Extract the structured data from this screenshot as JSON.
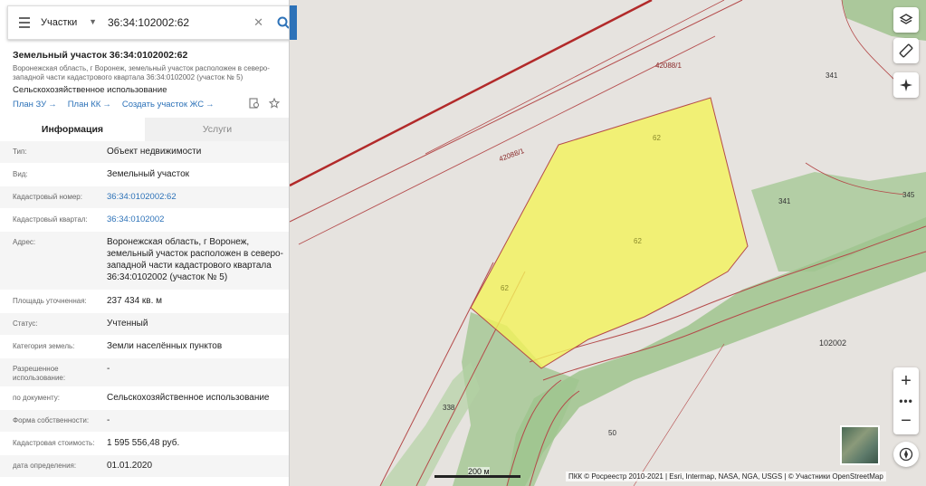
{
  "search": {
    "type": "Участки",
    "value": "36:34:102002:62"
  },
  "object": {
    "title": "Земельный участок 36:34:0102002:62",
    "address_short": "Воронежская область, г Воронеж, земельный участок расположен в северо-западной части кадастрового квартала 36:34:0102002 (участок № 5)",
    "use": "Сельскохозяйственное использование",
    "links": [
      {
        "label": "План ЗУ",
        "arrow": "→"
      },
      {
        "label": "План КК",
        "arrow": "→"
      },
      {
        "label": "Создать участок ЖС",
        "arrow": "→"
      }
    ]
  },
  "tabs": [
    {
      "label": "Информация",
      "active": true
    },
    {
      "label": "Услуги",
      "active": false
    }
  ],
  "rows": [
    {
      "key": "Тип:",
      "value": "Объект недвижимости"
    },
    {
      "key": "Вид:",
      "value": "Земельный участок"
    },
    {
      "key": "Кадастровый номер:",
      "value": "36:34:0102002:62",
      "link": true
    },
    {
      "key": "Кадастровый квартал:",
      "value": "36:34:0102002",
      "link": true
    },
    {
      "key": "Адрес:",
      "value": "Воронежская область, г Воронеж, земельный участок расположен в северо-западной части кадастрового квартала 36:34:0102002 (участок № 5)"
    },
    {
      "key": "Площадь уточненная:",
      "value": "237 434 кв. м"
    },
    {
      "key": "Статус:",
      "value": "Учтенный"
    },
    {
      "key": "Категория земель:",
      "value": "Земли населённых пунктов"
    },
    {
      "key": "Разрешенное использование:",
      "value": "-"
    },
    {
      "key": "по документу:",
      "value": "Сельскохозяйственное использование"
    },
    {
      "key": "Форма собственности:",
      "value": "-"
    },
    {
      "key": "Кадастровая стоимость:",
      "value": "1 595 556,48 руб."
    },
    {
      "key": "дата определения:",
      "value": "01.01.2020"
    }
  ],
  "map": {
    "labels": {
      "l42088_top": "42088/1",
      "l42088_diag": "42088/1",
      "l341_top": "341",
      "l341_mid": "341",
      "l345": "345",
      "l62_a": "62",
      "l62_b": "62",
      "l62_c": "62",
      "l102002": "102002",
      "l338": "338",
      "l50": "50"
    },
    "scale": "200 м",
    "attribution": "ПКК © Росреестр 2010-2021 | Esri, Intermap, NASA, NGA, USGS | © Участники OpenStreetMap",
    "zoom_in": "+",
    "zoom_out": "−",
    "zoom_more": "•••"
  },
  "colors": {
    "accent": "#2d72b8",
    "parcel_fill": "#f4f25a",
    "border_red": "#b22a2a"
  },
  "icons": [
    "menu-icon",
    "chevron-down-icon",
    "clear-icon",
    "search-icon",
    "layers-icon",
    "ruler-icon",
    "locate-icon",
    "print-icon",
    "star-icon",
    "compass-icon"
  ]
}
